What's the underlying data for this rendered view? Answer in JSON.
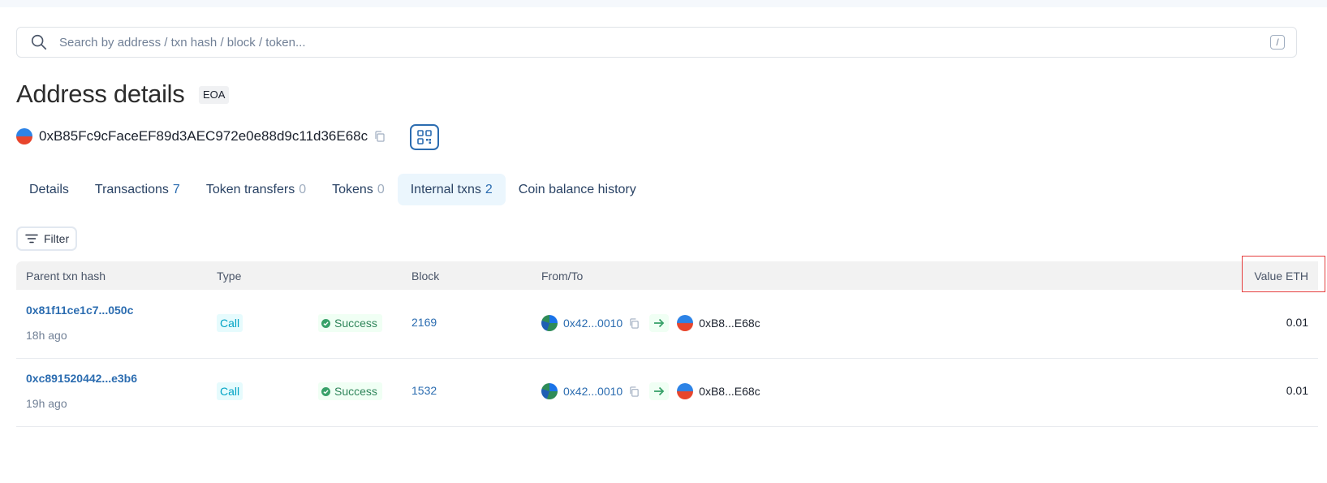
{
  "search": {
    "placeholder": "Search by address / txn hash / block / token...",
    "shortcut": "/"
  },
  "page": {
    "title": "Address details",
    "badge": "EOA"
  },
  "address": {
    "hash": "0xB85Fc9cFaceEF89d3AEC972e0e88d9c11d36E68c"
  },
  "tabs": [
    {
      "label": "Details",
      "count": ""
    },
    {
      "label": "Transactions",
      "count": "7"
    },
    {
      "label": "Token transfers",
      "count": "0"
    },
    {
      "label": "Tokens",
      "count": "0"
    },
    {
      "label": "Internal txns",
      "count": "2"
    },
    {
      "label": "Coin balance history",
      "count": ""
    }
  ],
  "active_tab": "Internal txns",
  "filter": {
    "label": "Filter"
  },
  "table": {
    "headers": {
      "parent_hash": "Parent txn hash",
      "type": "Type",
      "block": "Block",
      "from_to": "From/To",
      "value": "Value ETH"
    },
    "rows": [
      {
        "hash": "0x81f11ce1c7...050c",
        "age": "18h ago",
        "type": "Call",
        "status": "Success",
        "block": "2169",
        "from": "0x42...0010",
        "to": "0xB8...E68c",
        "value": "0.01"
      },
      {
        "hash": "0xc891520442...e3b6",
        "age": "19h ago",
        "type": "Call",
        "status": "Success",
        "block": "1532",
        "from": "0x42...0010",
        "to": "0xB8...E68c",
        "value": "0.01"
      }
    ]
  },
  "colors": {
    "link": "#2b6cb0",
    "highlight_border": "#e53e3e",
    "success": "#2f855a",
    "type_badge": "#00a3c4"
  }
}
